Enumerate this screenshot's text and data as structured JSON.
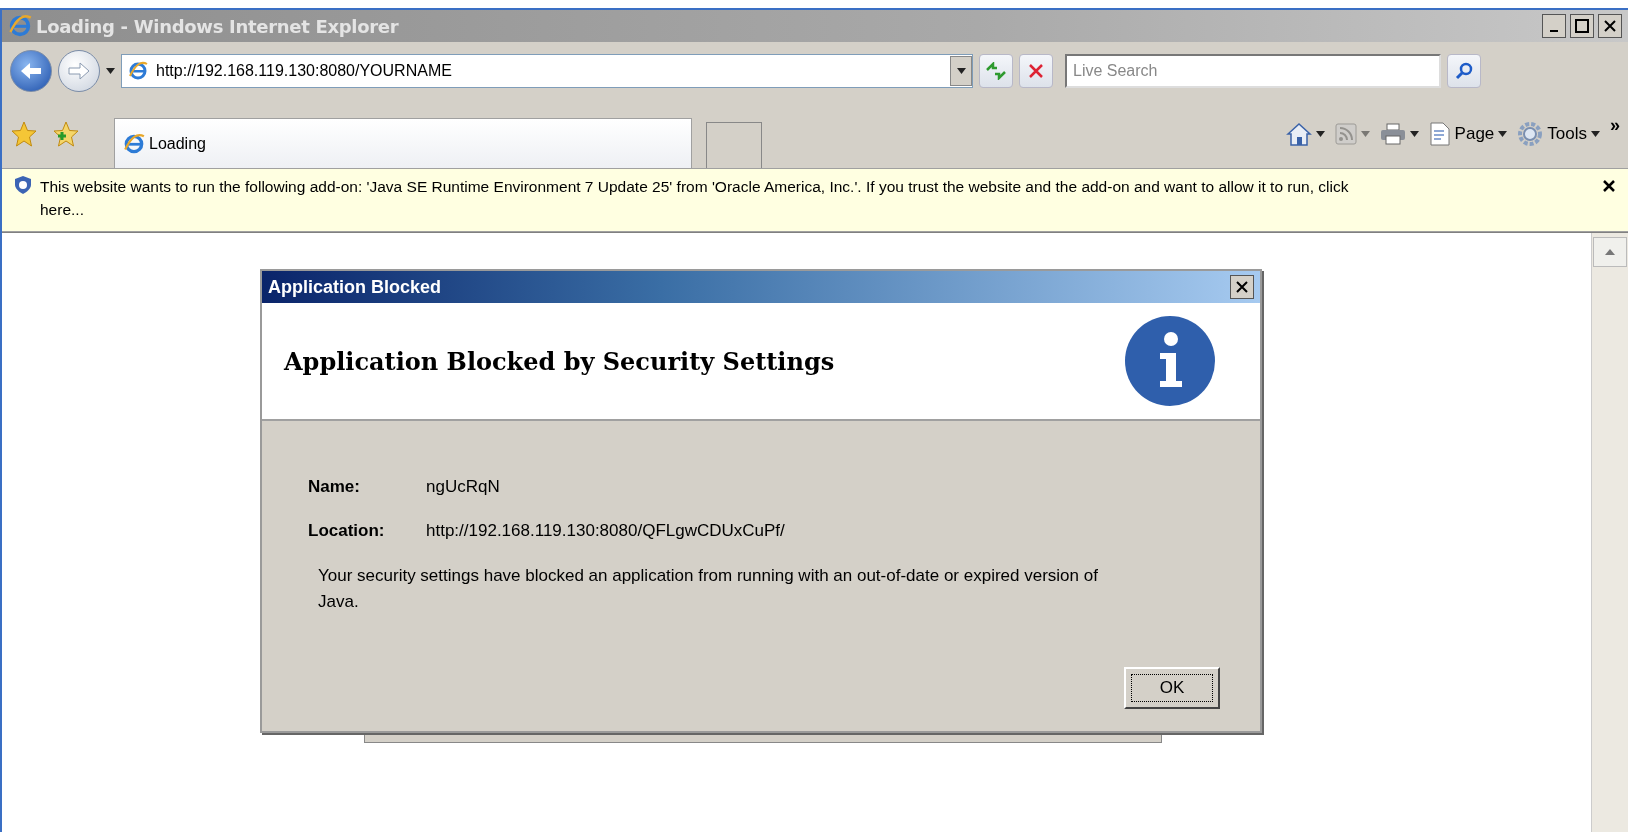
{
  "window": {
    "title": "Loading - Windows Internet Explorer"
  },
  "address_bar": {
    "value": "http://192.168.119.130:8080/YOURNAME"
  },
  "search": {
    "placeholder": "Live Search"
  },
  "tabs": [
    {
      "label": "Loading",
      "selected": true
    }
  ],
  "command_bar": [
    {
      "kind": "home",
      "disabled": false
    },
    {
      "kind": "feeds",
      "disabled": true
    },
    {
      "kind": "print",
      "disabled": false
    },
    {
      "kind": "page",
      "label": "Page",
      "disabled": false
    },
    {
      "kind": "tools",
      "label": "Tools",
      "disabled": false
    }
  ],
  "command_overflow": "»",
  "info_bar": {
    "text": "This website wants to run the following add-on: 'Java SE Runtime Environment 7 Update 25' from 'Oracle America, Inc.'. If you trust the website and the add-on and want to allow it to run, click here..."
  },
  "dialog": {
    "title": "Application Blocked",
    "heading": "Application Blocked by Security Settings",
    "fields": [
      {
        "label": "Name:",
        "value": "ngUcRqN"
      },
      {
        "label": "Location:",
        "value": "http://192.168.119.130:8080/QFLgwCDUxCuPf/"
      }
    ],
    "message": "Your security settings have blocked an application from running with an out-of-date or expired version of Java.",
    "buttons": [
      {
        "label": "OK",
        "focused": true
      }
    ]
  }
}
